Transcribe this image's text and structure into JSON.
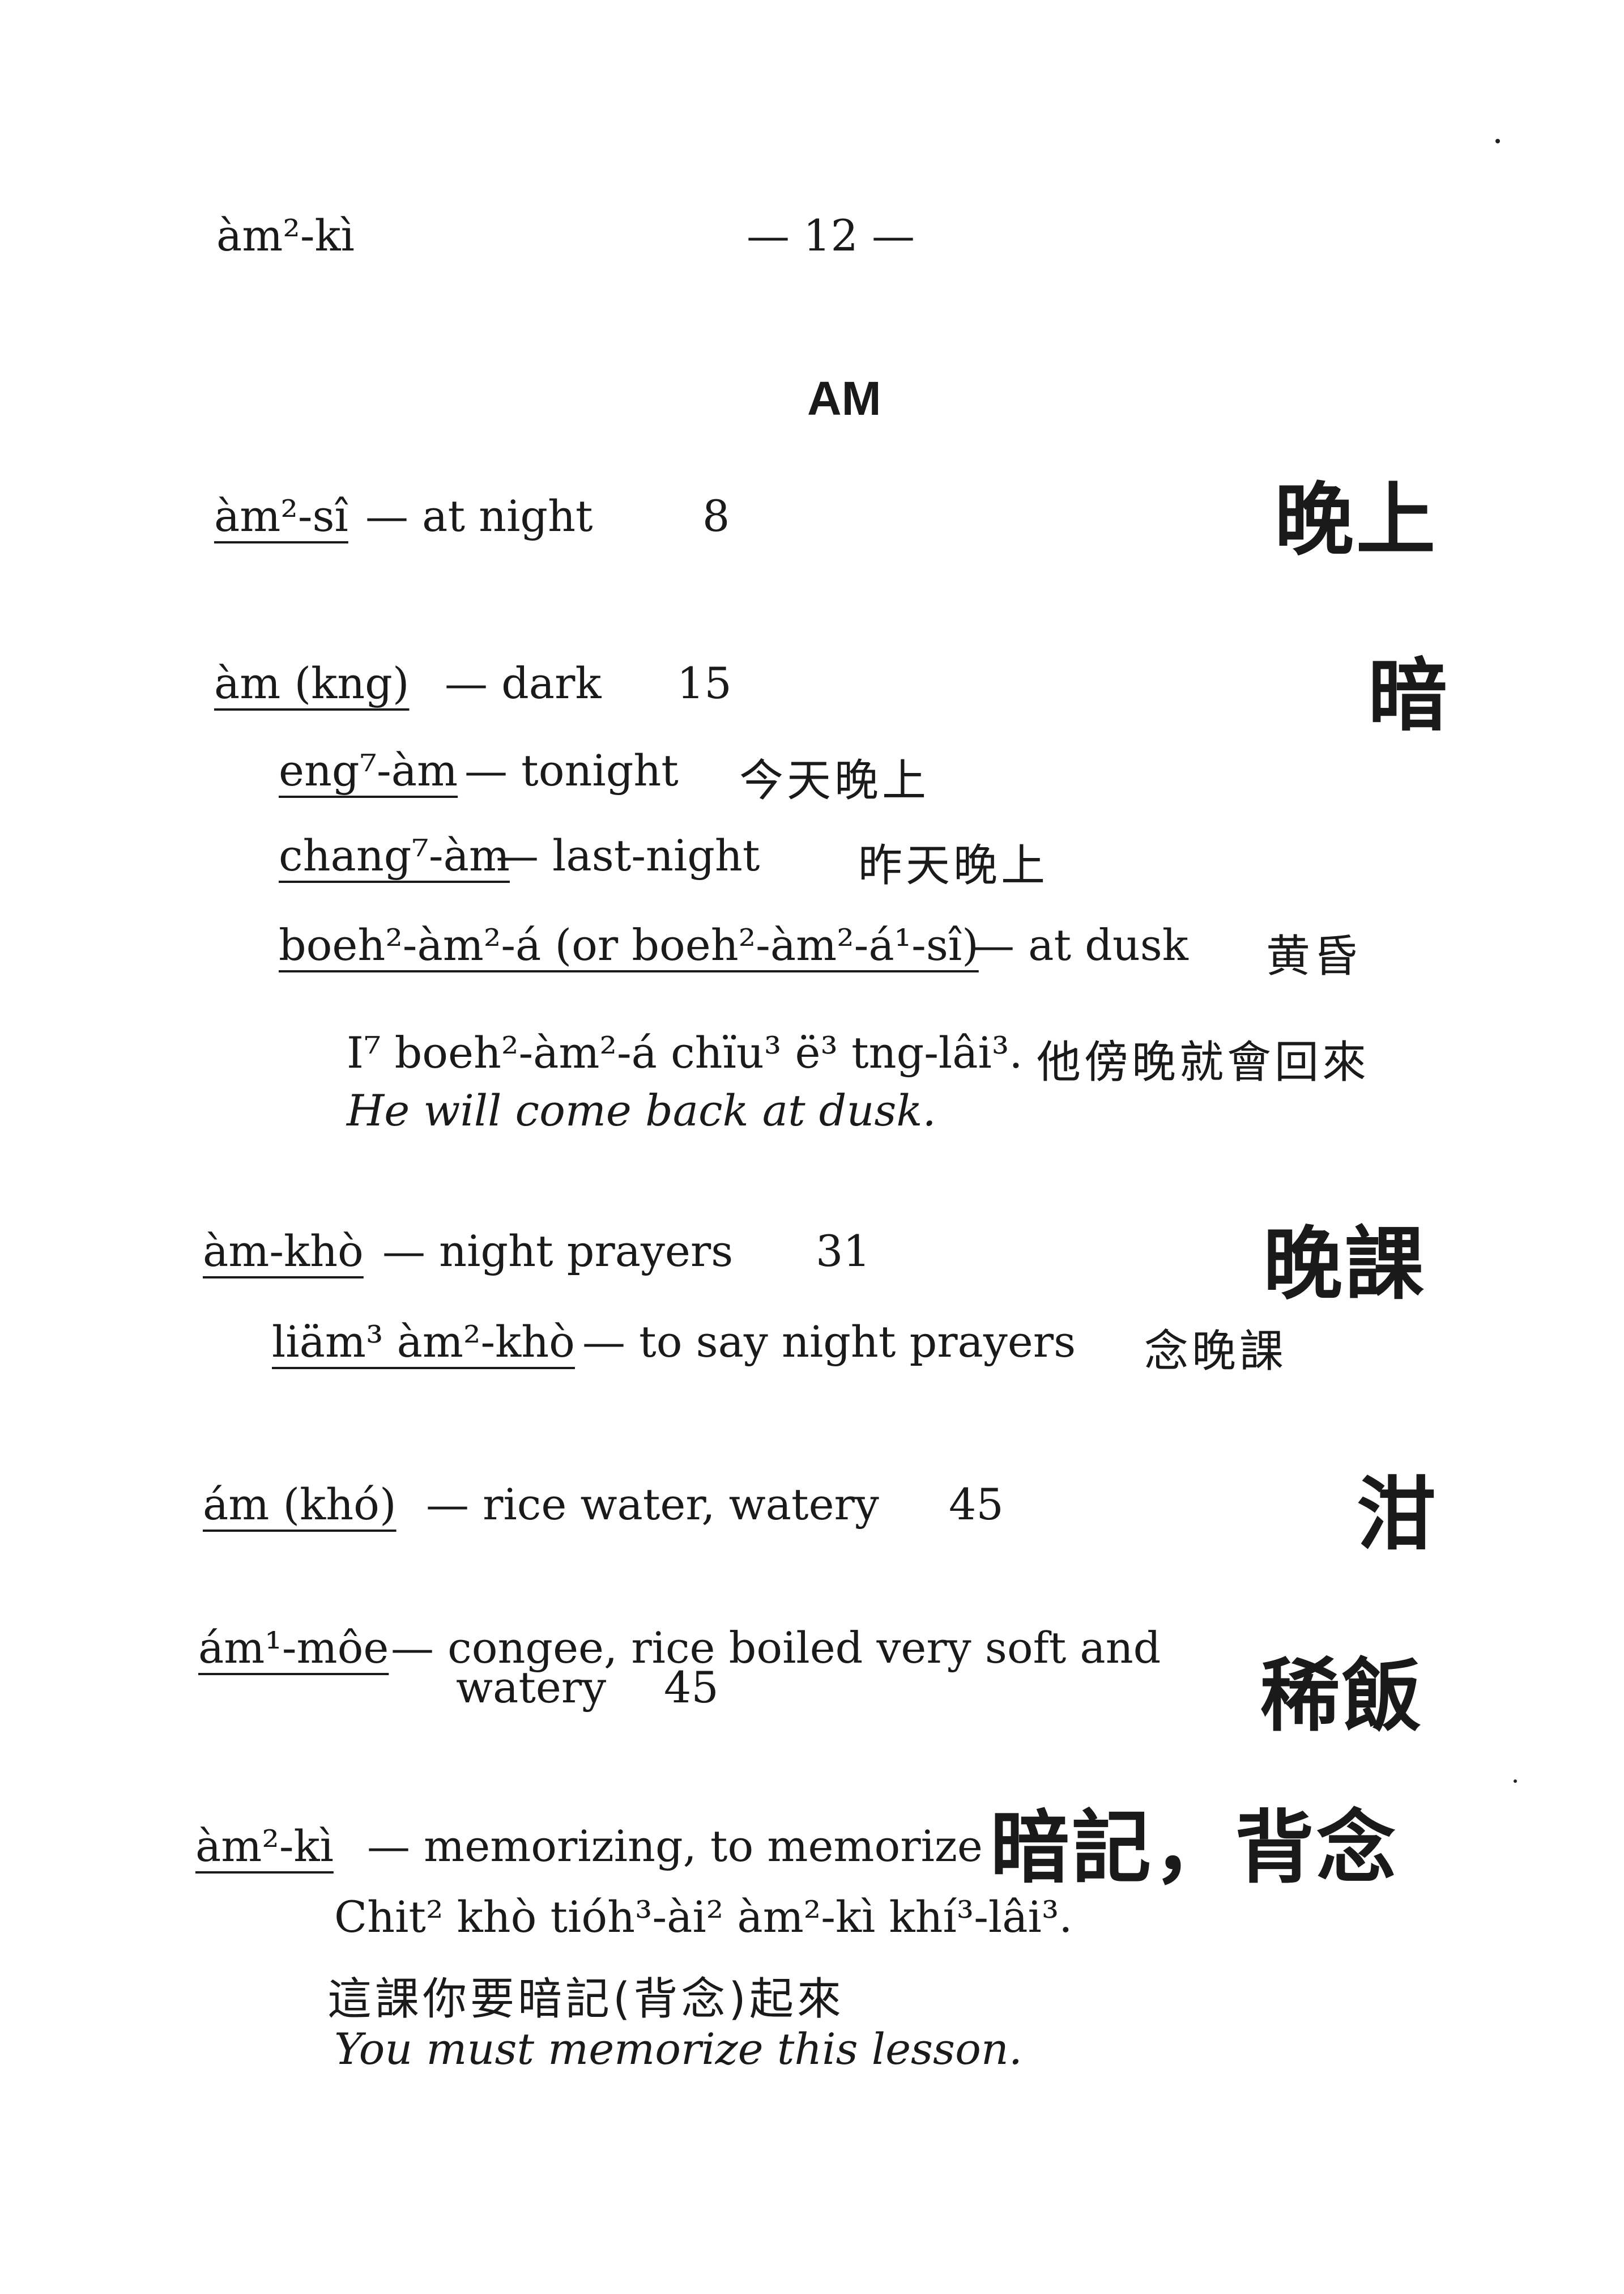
{
  "header": {
    "running_head": "àm²-kì",
    "page_number": "— 12 —"
  },
  "section": {
    "title": "AM"
  },
  "entries": {
    "e1": {
      "headword": "àm²-sî",
      "gloss": "— at night",
      "lesson": "8",
      "hanzi": "晚上"
    },
    "e2": {
      "headword": "àm (kng)",
      "gloss": "— dark",
      "lesson": "15",
      "hanzi": "暗",
      "s1": {
        "term": "eng⁷-àm",
        "gloss": "— tonight",
        "hanzi": "今天晚上"
      },
      "s2": {
        "term": "chang⁷-àm",
        "gloss": "— last-night",
        "hanzi": "昨天晚上"
      },
      "s3": {
        "term": "boeh²-àm²-á (or boeh²-àm²-á¹-sî)",
        "gloss": "— at dusk",
        "hanzi": "黄昏"
      },
      "example": {
        "romanized": "I⁷ boeh²-àm²-á chïu³ ë³ tng-lâi³.",
        "hanzi": "他傍晚就會回來",
        "english": "He will come back at dusk."
      }
    },
    "e3": {
      "headword": "àm-khò",
      "gloss": "— night prayers",
      "lesson": "31",
      "hanzi": "晚課",
      "s1": {
        "term": "liäm³ àm²-khò",
        "gloss": "— to say night prayers",
        "hanzi": "念晚課"
      }
    },
    "e4": {
      "headword": "ám (khó)",
      "gloss": "— rice water, watery",
      "lesson": "45",
      "hanzi": "泔"
    },
    "e5": {
      "headword": "ám¹-môe",
      "gloss_line1": "— congee, rice boiled very soft and",
      "gloss_line2": "watery",
      "lesson": "45",
      "hanzi": "稀飯"
    },
    "e6": {
      "headword": "àm²-kì",
      "gloss": "— memorizing, to memorize",
      "hanzi": "暗記，背念",
      "example": {
        "romanized": "Chit² khò tióh³-ài² àm²-kì khí³-lâi³.",
        "hanzi": "這課你要暗記(背念)起來",
        "english": "You must memorize this lesson."
      }
    }
  }
}
